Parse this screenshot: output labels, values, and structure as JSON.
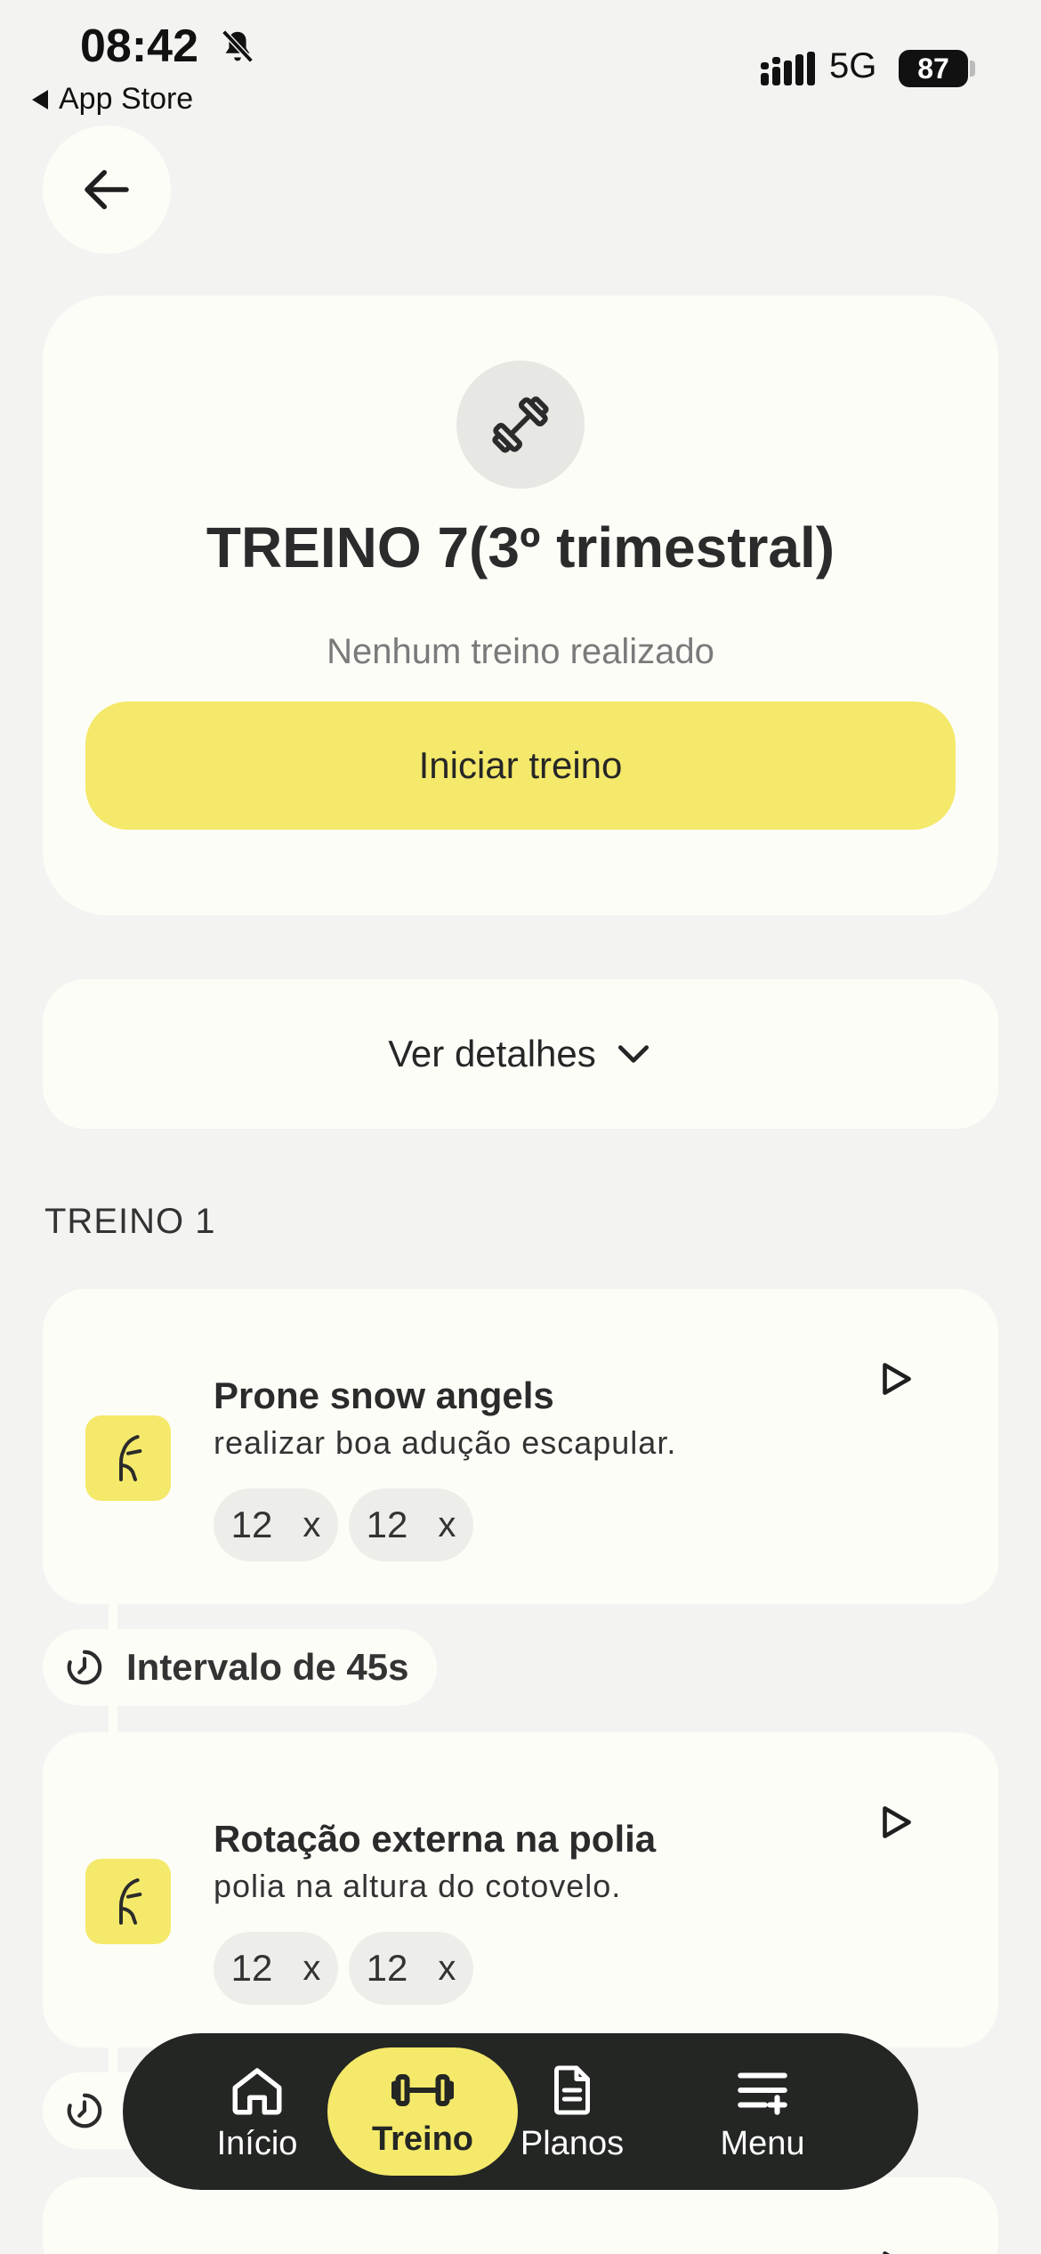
{
  "status": {
    "time": "08:42",
    "back_app": "App Store",
    "network": "5G",
    "battery": "87"
  },
  "workout": {
    "title": "TREINO 7(3º trimestral)",
    "subtitle": "Nenhum treino realizado",
    "start_label": "Iniciar treino",
    "details_label": "Ver detalhes"
  },
  "section": {
    "label": "TREINO 1"
  },
  "exercises": [
    {
      "name": "Prone snow angels",
      "description": "realizar boa adução escapular.",
      "sets": [
        {
          "reps": "12",
          "x": "x"
        },
        {
          "reps": "12",
          "x": "x"
        }
      ]
    },
    {
      "name": "Rotação externa na polia",
      "description": "polia na altura do cotovelo.",
      "sets": [
        {
          "reps": "12",
          "x": "x"
        },
        {
          "reps": "12",
          "x": "x"
        }
      ]
    }
  ],
  "intervals": [
    {
      "label": "Intervalo de 45s"
    }
  ],
  "nav": {
    "items": [
      {
        "label": "Início",
        "icon": "home-icon"
      },
      {
        "label": "Treino",
        "icon": "dumbbell-icon",
        "active": true
      },
      {
        "label": "Planos",
        "icon": "document-icon"
      },
      {
        "label": "Menu",
        "icon": "menu-add-icon"
      }
    ]
  },
  "colors": {
    "accent": "#f4e96a",
    "background": "#f3f3f1",
    "card": "#fdfdf8",
    "nav_bg": "#232623"
  }
}
